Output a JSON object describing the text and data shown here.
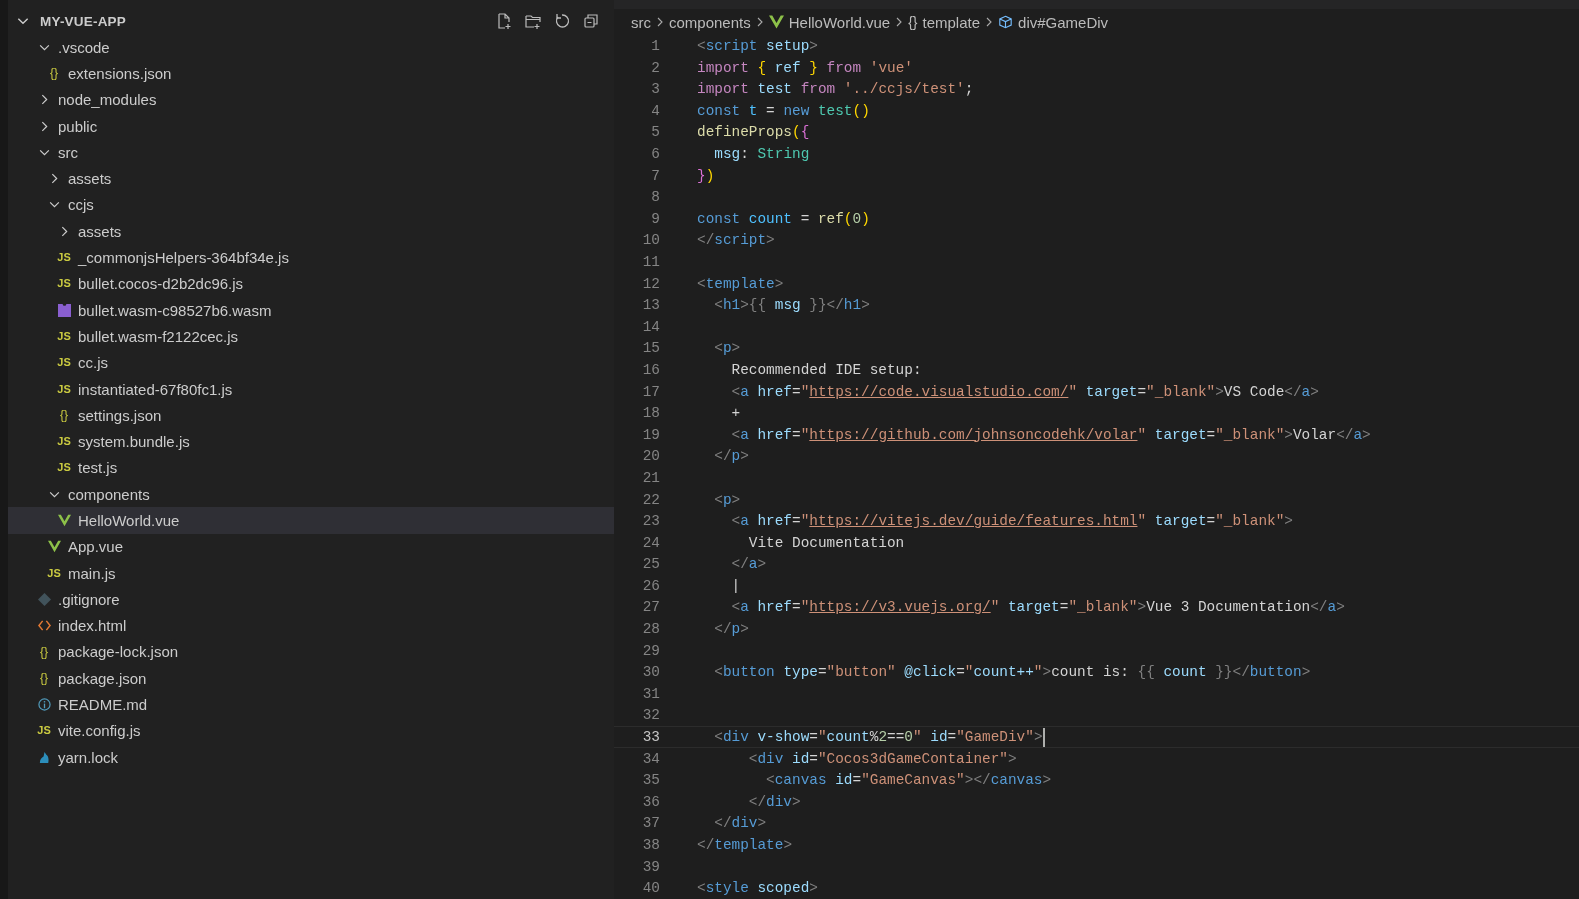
{
  "explorer": {
    "title": "MY-VUE-APP",
    "expanded": true,
    "items": [
      {
        "name": ".vscode",
        "kind": "folder",
        "expanded": true,
        "selected": false,
        "children": [
          {
            "name": "extensions.json",
            "kind": "json",
            "badge": "{}",
            "selected": false
          }
        ]
      },
      {
        "name": "node_modules",
        "kind": "folder",
        "expanded": false,
        "selected": false
      },
      {
        "name": "public",
        "kind": "folder",
        "expanded": false,
        "selected": false
      },
      {
        "name": "src",
        "kind": "folder",
        "expanded": true,
        "selected": false,
        "children": [
          {
            "name": "assets",
            "kind": "folder",
            "expanded": false,
            "selected": false
          },
          {
            "name": "ccjs",
            "kind": "folder",
            "expanded": true,
            "selected": false,
            "children": [
              {
                "name": "assets",
                "kind": "folder",
                "expanded": false,
                "selected": false
              },
              {
                "name": "_commonjsHelpers-364bf34e.js",
                "kind": "js",
                "badge": "JS",
                "selected": false
              },
              {
                "name": "bullet.cocos-d2b2dc96.js",
                "kind": "js",
                "badge": "JS",
                "selected": false
              },
              {
                "name": "bullet.wasm-c98527b6.wasm",
                "kind": "wasm",
                "selected": false
              },
              {
                "name": "bullet.wasm-f2122cec.js",
                "kind": "js",
                "badge": "JS",
                "selected": false
              },
              {
                "name": "cc.js",
                "kind": "js",
                "badge": "JS",
                "selected": false
              },
              {
                "name": "instantiated-67f80fc1.js",
                "kind": "js",
                "badge": "JS",
                "selected": false
              },
              {
                "name": "settings.json",
                "kind": "json",
                "badge": "{}",
                "selected": false
              },
              {
                "name": "system.bundle.js",
                "kind": "js",
                "badge": "JS",
                "selected": false
              },
              {
                "name": "test.js",
                "kind": "js",
                "badge": "JS",
                "selected": false
              }
            ]
          },
          {
            "name": "components",
            "kind": "folder",
            "expanded": true,
            "selected": false,
            "children": [
              {
                "name": "HelloWorld.vue",
                "kind": "vue",
                "selected": true
              }
            ]
          },
          {
            "name": "App.vue",
            "kind": "vue",
            "selected": false
          },
          {
            "name": "main.js",
            "kind": "js",
            "badge": "JS",
            "selected": false
          }
        ]
      },
      {
        "name": ".gitignore",
        "kind": "git",
        "selected": false
      },
      {
        "name": "index.html",
        "kind": "html",
        "selected": false
      },
      {
        "name": "package-lock.json",
        "kind": "json",
        "badge": "{}",
        "selected": false
      },
      {
        "name": "package.json",
        "kind": "json",
        "badge": "{}",
        "selected": false
      },
      {
        "name": "README.md",
        "kind": "info",
        "selected": false
      },
      {
        "name": "vite.config.js",
        "kind": "js",
        "badge": "JS",
        "selected": false
      },
      {
        "name": "yarn.lock",
        "kind": "yarn",
        "selected": false
      }
    ]
  },
  "breadcrumb": [
    {
      "label": "src",
      "kind": "plain"
    },
    {
      "label": "components",
      "kind": "plain"
    },
    {
      "label": "HelloWorld.vue",
      "kind": "vue"
    },
    {
      "label": "template",
      "kind": "braces",
      "badge": "{}"
    },
    {
      "label": "div#GameDiv",
      "kind": "cube"
    }
  ],
  "editor": {
    "lines": [
      {
        "number": "1",
        "current": false,
        "tokens": [
          {
            "text": "<",
            "kind": "punct"
          },
          {
            "text": "script",
            "kind": "tag"
          },
          {
            "text": " setup",
            "kind": "attr"
          },
          {
            "text": ">",
            "kind": "punct"
          }
        ]
      },
      {
        "number": "2",
        "current": false,
        "tokens": [
          {
            "text": "import ",
            "kind": "keyword"
          },
          {
            "text": "{",
            "kind": "bracket1"
          },
          {
            "text": " ref ",
            "kind": "attr"
          },
          {
            "text": "}",
            "kind": "bracket1"
          },
          {
            "text": " from",
            "kind": "keyword"
          },
          {
            "text": " 'vue'",
            "kind": "string"
          }
        ]
      },
      {
        "number": "3",
        "current": false,
        "tokens": [
          {
            "text": "import",
            "kind": "keyword"
          },
          {
            "text": " test",
            "kind": "attr"
          },
          {
            "text": " from",
            "kind": "keyword"
          },
          {
            "text": " '../ccjs/test'",
            "kind": "string"
          },
          {
            "text": ";",
            "kind": "text"
          }
        ]
      },
      {
        "number": "4",
        "current": false,
        "tokens": [
          {
            "text": "const",
            "kind": "storage"
          },
          {
            "text": " t",
            "kind": "constant"
          },
          {
            "text": " = ",
            "kind": "text"
          },
          {
            "text": "new",
            "kind": "storage"
          },
          {
            "text": " test",
            "kind": "class"
          },
          {
            "text": "()",
            "kind": "bracket1"
          }
        ]
      },
      {
        "number": "5",
        "current": false,
        "tokens": [
          {
            "text": "defineProps",
            "kind": "func"
          },
          {
            "text": "(",
            "kind": "bracket1"
          },
          {
            "text": "{",
            "kind": "bracket2"
          }
        ]
      },
      {
        "number": "6",
        "current": false,
        "tokens": [
          {
            "text": "  msg",
            "kind": "attr"
          },
          {
            "text": ": ",
            "kind": "text"
          },
          {
            "text": "String",
            "kind": "class"
          }
        ]
      },
      {
        "number": "7",
        "current": false,
        "tokens": [
          {
            "text": "}",
            "kind": "bracket2"
          },
          {
            "text": ")",
            "kind": "bracket1"
          }
        ]
      },
      {
        "number": "8",
        "current": false
      },
      {
        "number": "9",
        "current": false,
        "tokens": [
          {
            "text": "const",
            "kind": "storage"
          },
          {
            "text": " count",
            "kind": "constant"
          },
          {
            "text": " = ",
            "kind": "text"
          },
          {
            "text": "ref",
            "kind": "func"
          },
          {
            "text": "(",
            "kind": "bracket1"
          },
          {
            "text": "0",
            "kind": "number"
          },
          {
            "text": ")",
            "kind": "bracket1"
          }
        ]
      },
      {
        "number": "10",
        "current": false,
        "tokens": [
          {
            "text": "</",
            "kind": "punct"
          },
          {
            "text": "script",
            "kind": "tag"
          },
          {
            "text": ">",
            "kind": "punct"
          }
        ]
      },
      {
        "number": "11",
        "current": false
      },
      {
        "number": "12",
        "current": false,
        "tokens": [
          {
            "text": "<",
            "kind": "punct"
          },
          {
            "text": "template",
            "kind": "tag"
          },
          {
            "text": ">",
            "kind": "punct"
          }
        ]
      },
      {
        "number": "13",
        "current": false,
        "tokens": [
          {
            "text": "  <",
            "kind": "punct"
          },
          {
            "text": "h1",
            "kind": "tag"
          },
          {
            "text": ">{{ ",
            "kind": "punct"
          },
          {
            "text": "msg",
            "kind": "attr"
          },
          {
            "text": " }}</",
            "kind": "punct"
          },
          {
            "text": "h1",
            "kind": "tag"
          },
          {
            "text": ">",
            "kind": "punct"
          }
        ]
      },
      {
        "number": "14",
        "current": false
      },
      {
        "number": "15",
        "current": false,
        "tokens": [
          {
            "text": "  <",
            "kind": "punct"
          },
          {
            "text": "p",
            "kind": "tag"
          },
          {
            "text": ">",
            "kind": "punct"
          }
        ]
      },
      {
        "number": "16",
        "current": false,
        "tokens": [
          {
            "text": "    Recommended IDE setup:",
            "kind": "text"
          }
        ]
      },
      {
        "number": "17",
        "current": false,
        "tokens": [
          {
            "text": "    <",
            "kind": "punct"
          },
          {
            "text": "a",
            "kind": "tag"
          },
          {
            "text": " href",
            "kind": "attr"
          },
          {
            "text": "=",
            "kind": "text"
          },
          {
            "text": "\"",
            "kind": "string"
          },
          {
            "text": "https://code.visualstudio.com/",
            "kind": "link"
          },
          {
            "text": "\"",
            "kind": "string"
          },
          {
            "text": " target",
            "kind": "attr"
          },
          {
            "text": "=",
            "kind": "text"
          },
          {
            "text": "\"_blank\"",
            "kind": "string"
          },
          {
            "text": ">",
            "kind": "punct"
          },
          {
            "text": "VS Code",
            "kind": "text"
          },
          {
            "text": "</",
            "kind": "punct"
          },
          {
            "text": "a",
            "kind": "tag"
          },
          {
            "text": ">",
            "kind": "punct"
          }
        ]
      },
      {
        "number": "18",
        "current": false,
        "tokens": [
          {
            "text": "    +",
            "kind": "text"
          }
        ]
      },
      {
        "number": "19",
        "current": false,
        "tokens": [
          {
            "text": "    <",
            "kind": "punct"
          },
          {
            "text": "a",
            "kind": "tag"
          },
          {
            "text": " href",
            "kind": "attr"
          },
          {
            "text": "=",
            "kind": "text"
          },
          {
            "text": "\"",
            "kind": "string"
          },
          {
            "text": "https://github.com/johnsoncodehk/volar",
            "kind": "link"
          },
          {
            "text": "\"",
            "kind": "string"
          },
          {
            "text": " target",
            "kind": "attr"
          },
          {
            "text": "=",
            "kind": "text"
          },
          {
            "text": "\"_blank\"",
            "kind": "string"
          },
          {
            "text": ">",
            "kind": "punct"
          },
          {
            "text": "Volar",
            "kind": "text"
          },
          {
            "text": "</",
            "kind": "punct"
          },
          {
            "text": "a",
            "kind": "tag"
          },
          {
            "text": ">",
            "kind": "punct"
          }
        ]
      },
      {
        "number": "20",
        "current": false,
        "tokens": [
          {
            "text": "  </",
            "kind": "punct"
          },
          {
            "text": "p",
            "kind": "tag"
          },
          {
            "text": ">",
            "kind": "punct"
          }
        ]
      },
      {
        "number": "21",
        "current": false
      },
      {
        "number": "22",
        "current": false,
        "tokens": [
          {
            "text": "  <",
            "kind": "punct"
          },
          {
            "text": "p",
            "kind": "tag"
          },
          {
            "text": ">",
            "kind": "punct"
          }
        ]
      },
      {
        "number": "23",
        "current": false,
        "tokens": [
          {
            "text": "    <",
            "kind": "punct"
          },
          {
            "text": "a",
            "kind": "tag"
          },
          {
            "text": " href",
            "kind": "attr"
          },
          {
            "text": "=",
            "kind": "text"
          },
          {
            "text": "\"",
            "kind": "string"
          },
          {
            "text": "https://vitejs.dev/guide/features.html",
            "kind": "link"
          },
          {
            "text": "\"",
            "kind": "string"
          },
          {
            "text": " target",
            "kind": "attr"
          },
          {
            "text": "=",
            "kind": "text"
          },
          {
            "text": "\"_blank\"",
            "kind": "string"
          },
          {
            "text": ">",
            "kind": "punct"
          }
        ]
      },
      {
        "number": "24",
        "current": false,
        "tokens": [
          {
            "text": "      Vite Documentation",
            "kind": "text"
          }
        ]
      },
      {
        "number": "25",
        "current": false,
        "tokens": [
          {
            "text": "    </",
            "kind": "punct"
          },
          {
            "text": "a",
            "kind": "tag"
          },
          {
            "text": ">",
            "kind": "punct"
          }
        ]
      },
      {
        "number": "26",
        "current": false,
        "tokens": [
          {
            "text": "    |",
            "kind": "text"
          }
        ]
      },
      {
        "number": "27",
        "current": false,
        "tokens": [
          {
            "text": "    <",
            "kind": "punct"
          },
          {
            "text": "a",
            "kind": "tag"
          },
          {
            "text": " href",
            "kind": "attr"
          },
          {
            "text": "=",
            "kind": "text"
          },
          {
            "text": "\"",
            "kind": "string"
          },
          {
            "text": "https://v3.vuejs.org/",
            "kind": "link"
          },
          {
            "text": "\"",
            "kind": "string"
          },
          {
            "text": " target",
            "kind": "attr"
          },
          {
            "text": "=",
            "kind": "text"
          },
          {
            "text": "\"_blank\"",
            "kind": "string"
          },
          {
            "text": ">",
            "kind": "punct"
          },
          {
            "text": "Vue 3 Documentation",
            "kind": "text"
          },
          {
            "text": "</",
            "kind": "punct"
          },
          {
            "text": "a",
            "kind": "tag"
          },
          {
            "text": ">",
            "kind": "punct"
          }
        ]
      },
      {
        "number": "28",
        "current": false,
        "tokens": [
          {
            "text": "  </",
            "kind": "punct"
          },
          {
            "text": "p",
            "kind": "tag"
          },
          {
            "text": ">",
            "kind": "punct"
          }
        ]
      },
      {
        "number": "29",
        "current": false
      },
      {
        "number": "30",
        "current": false,
        "tokens": [
          {
            "text": "  <",
            "kind": "punct"
          },
          {
            "text": "button",
            "kind": "tag"
          },
          {
            "text": " type",
            "kind": "attr"
          },
          {
            "text": "=",
            "kind": "text"
          },
          {
            "text": "\"button\"",
            "kind": "string"
          },
          {
            "text": " @click",
            "kind": "attr"
          },
          {
            "text": "=",
            "kind": "text"
          },
          {
            "text": "\"",
            "kind": "string"
          },
          {
            "text": "count++",
            "kind": "attr"
          },
          {
            "text": "\"",
            "kind": "string"
          },
          {
            "text": ">",
            "kind": "punct"
          },
          {
            "text": "count is: ",
            "kind": "text"
          },
          {
            "text": "{{",
            "kind": "punct"
          },
          {
            "text": " count ",
            "kind": "attr"
          },
          {
            "text": "}}",
            "kind": "punct"
          },
          {
            "text": "</",
            "kind": "punct"
          },
          {
            "text": "button",
            "kind": "tag"
          },
          {
            "text": ">",
            "kind": "punct"
          }
        ]
      },
      {
        "number": "31",
        "current": false
      },
      {
        "number": "32",
        "current": false
      },
      {
        "number": "33",
        "current": true,
        "tokens": [
          {
            "text": "  <",
            "kind": "punct"
          },
          {
            "text": "div",
            "kind": "tag"
          },
          {
            "text": " v-show",
            "kind": "attr"
          },
          {
            "text": "=",
            "kind": "text"
          },
          {
            "text": "\"",
            "kind": "string"
          },
          {
            "text": "count",
            "kind": "attr"
          },
          {
            "text": "%",
            "kind": "text"
          },
          {
            "text": "2",
            "kind": "number"
          },
          {
            "text": "==",
            "kind": "text"
          },
          {
            "text": "0",
            "kind": "number"
          },
          {
            "text": "\"",
            "kind": "string"
          },
          {
            "text": " id",
            "kind": "attr"
          },
          {
            "text": "=",
            "kind": "text"
          },
          {
            "text": "\"GameDiv\"",
            "kind": "string"
          },
          {
            "text": ">",
            "kind": "punct"
          }
        ]
      },
      {
        "number": "34",
        "current": false,
        "tokens": [
          {
            "text": "      <",
            "kind": "punct"
          },
          {
            "text": "div",
            "kind": "tag"
          },
          {
            "text": " id",
            "kind": "attr"
          },
          {
            "text": "=",
            "kind": "text"
          },
          {
            "text": "\"Cocos3dGameContainer\"",
            "kind": "string"
          },
          {
            "text": ">",
            "kind": "punct"
          }
        ]
      },
      {
        "number": "35",
        "current": false,
        "tokens": [
          {
            "text": "        <",
            "kind": "punct"
          },
          {
            "text": "canvas",
            "kind": "tag"
          },
          {
            "text": " id",
            "kind": "attr"
          },
          {
            "text": "=",
            "kind": "text"
          },
          {
            "text": "\"GameCanvas\"",
            "kind": "string"
          },
          {
            "text": "></",
            "kind": "punct"
          },
          {
            "text": "canvas",
            "kind": "tag"
          },
          {
            "text": ">",
            "kind": "punct"
          }
        ]
      },
      {
        "number": "36",
        "current": false,
        "tokens": [
          {
            "text": "      </",
            "kind": "punct"
          },
          {
            "text": "div",
            "kind": "tag"
          },
          {
            "text": ">",
            "kind": "punct"
          }
        ]
      },
      {
        "number": "37",
        "current": false,
        "tokens": [
          {
            "text": "  </",
            "kind": "punct"
          },
          {
            "text": "div",
            "kind": "tag"
          },
          {
            "text": ">",
            "kind": "punct"
          }
        ]
      },
      {
        "number": "38",
        "current": false,
        "tokens": [
          {
            "text": "</",
            "kind": "punct"
          },
          {
            "text": "template",
            "kind": "tag"
          },
          {
            "text": ">",
            "kind": "punct"
          }
        ]
      },
      {
        "number": "39",
        "current": false
      },
      {
        "number": "40",
        "current": false,
        "tokens": [
          {
            "text": "<",
            "kind": "punct"
          },
          {
            "text": "style",
            "kind": "tag"
          },
          {
            "text": " scoped",
            "kind": "attr"
          },
          {
            "text": ">",
            "kind": "punct"
          }
        ]
      }
    ]
  }
}
